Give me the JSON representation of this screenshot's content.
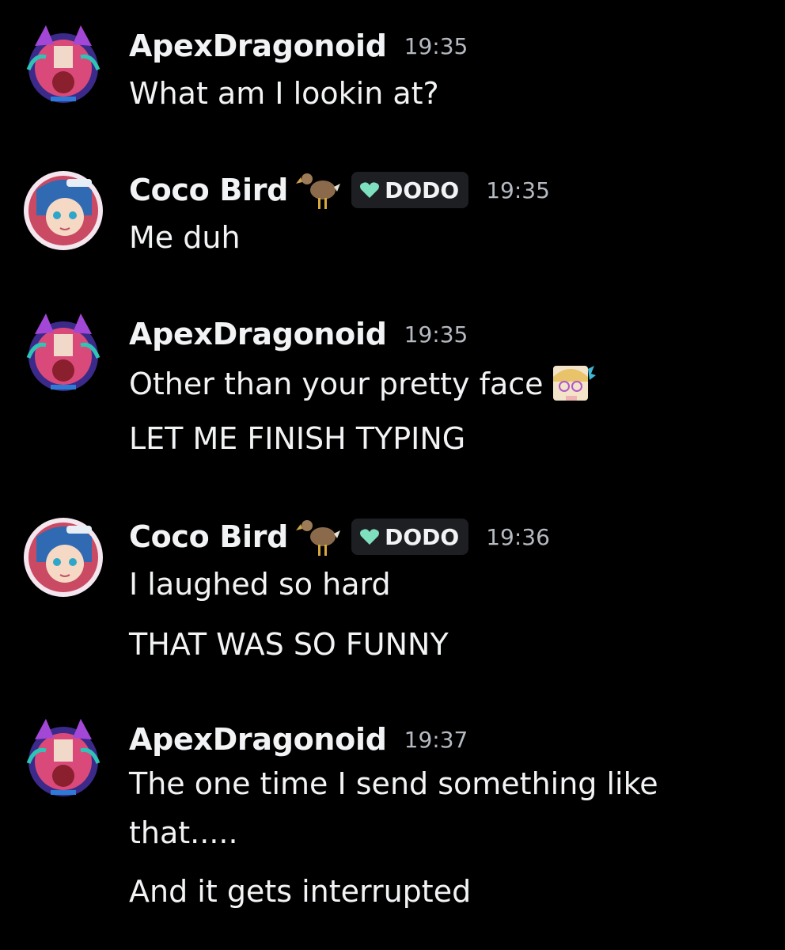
{
  "messages": [
    {
      "author": "ApexDragonoid",
      "avatar": "apex-avatar",
      "time": "19:35",
      "lines": [
        "What am I lookin at?"
      ]
    },
    {
      "author": "Coco Bird",
      "avatar": "coco-avatar",
      "decoration": "dodo-bird-emoji",
      "tag": "DODO",
      "tag_icon": "green-heart-icon",
      "time": "19:35",
      "lines": [
        "Me duh"
      ]
    },
    {
      "author": "ApexDragonoid",
      "avatar": "apex-avatar",
      "time": "19:35",
      "lines": [
        "Other than your pretty face",
        "LET ME FINISH TYPING"
      ],
      "inline_emoji": "anime-face-emoji"
    },
    {
      "author": "Coco Bird",
      "avatar": "coco-avatar",
      "decoration": "dodo-bird-emoji",
      "tag": "DODO",
      "tag_icon": "green-heart-icon",
      "time": "19:36",
      "lines": [
        "I laughed so hard",
        "THAT WAS SO FUNNY"
      ]
    },
    {
      "author": "ApexDragonoid",
      "avatar": "apex-avatar",
      "time": "19:37",
      "lines": [
        "The one time I send something like",
        "that.....",
        "And it gets interrupted"
      ]
    }
  ],
  "colors": {
    "background": "#000000",
    "text": "#f2f3f5",
    "timestamp": "#b5bac1",
    "tag_background": "#1e1f22",
    "tag_heart": "#7fe0c0"
  }
}
